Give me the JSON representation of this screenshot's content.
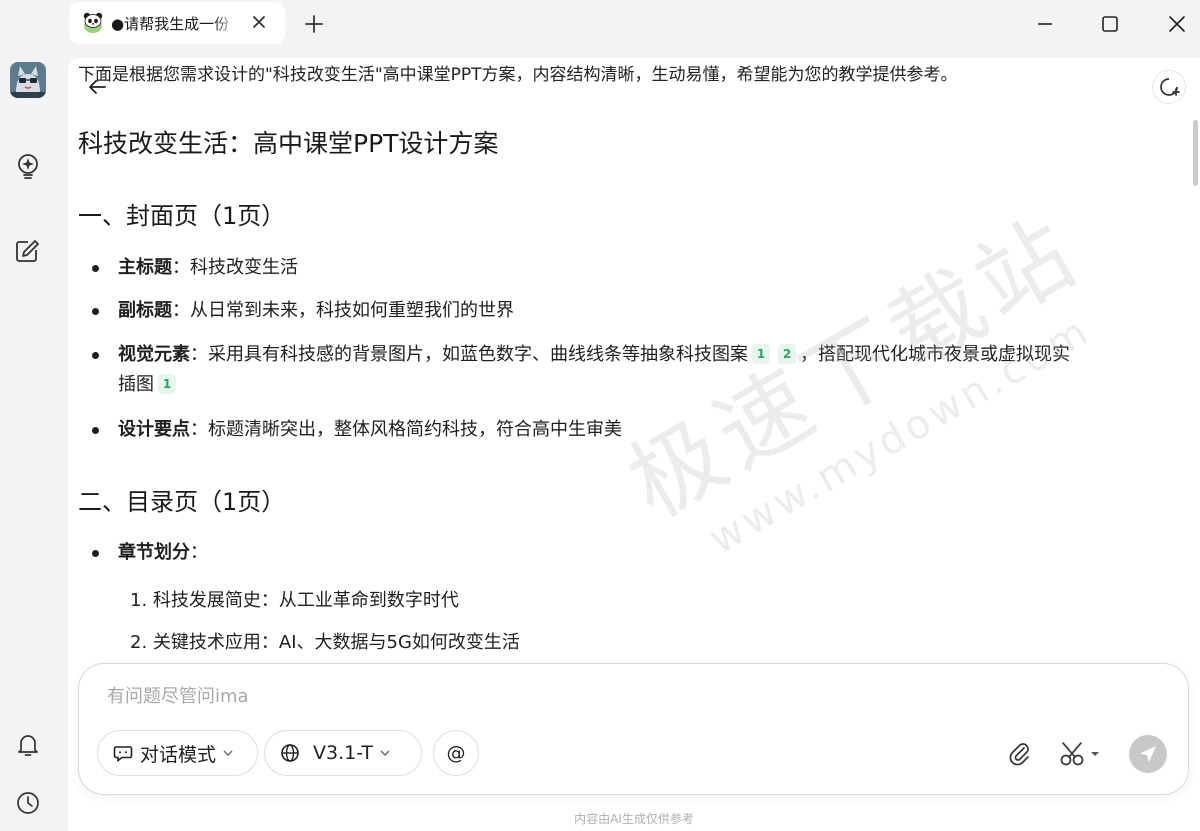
{
  "window": {
    "tab_title": "●请帮我生成一份",
    "new_tab_symbol": "+"
  },
  "rail": {
    "avatar": "avatar-cat",
    "icons": [
      "bulb-sparkle-icon",
      "edit-square-icon",
      "bell-icon",
      "clock-icon"
    ]
  },
  "content": {
    "intro": "下面是根据您需求设计的\"科技改变生活\"高中课堂PPT方案，内容结构清晰，生动易懂，希望能为您的教学提供参考。",
    "title": "科技改变生活：高中课堂PPT设计方案",
    "sections": [
      {
        "heading": "一、封面页（1页）",
        "bullets": [
          {
            "label": "主标题",
            "text": "：科技改变生活"
          },
          {
            "label": "副标题",
            "text": "：从日常到未来，科技如何重塑我们的世界"
          },
          {
            "label": "视觉元素",
            "text": "：采用具有科技感的背景图片，如蓝色数字、曲线线条等抽象科技图案",
            "cite1": "1",
            "cite2": "2",
            "text2": "，搭配现代化城市夜景或虚拟现实",
            "line2": "插图",
            "cite3": "1"
          },
          {
            "label": "设计要点",
            "text": "：标题清晰突出，整体风格简约科技，符合高中生审美"
          }
        ]
      },
      {
        "heading": "二、目录页（1页）",
        "bullets": [
          {
            "label": "章节划分",
            "text": "："
          }
        ],
        "ordered": [
          "1. 科技发展简史：从工业革命到数字时代",
          "2. 关键技术应用：AI、大数据与5G如何改变生活"
        ]
      }
    ]
  },
  "watermark": {
    "cn": "极速下载站",
    "url": "www.mydown.com"
  },
  "composer": {
    "placeholder": "有问题尽管问ima",
    "mode_label": "对话模式",
    "model_label": "V3.1-T",
    "at_label": "@"
  },
  "footer": {
    "disclaimer": "内容由AI生成仅供参考"
  }
}
